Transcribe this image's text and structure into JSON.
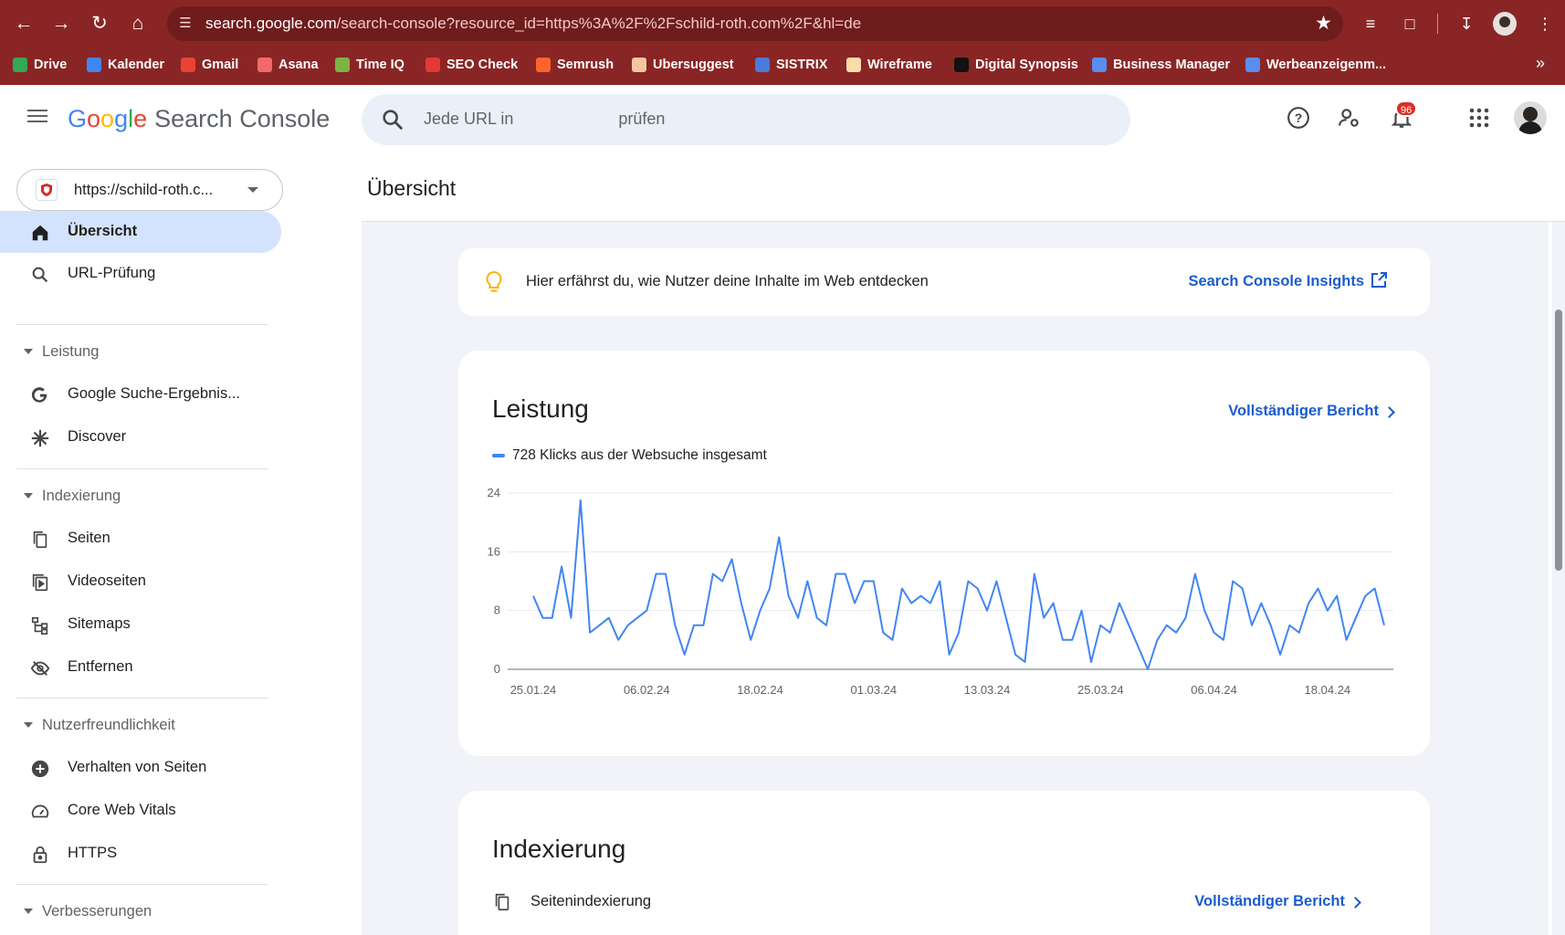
{
  "browser": {
    "url_host": "search.google.com",
    "url_rest": "/search-console?resource_id=https%3A%2F%2Fschild-roth.com%2F&hl=de",
    "bookmarks": [
      {
        "label": "Drive",
        "color": "#34a853"
      },
      {
        "label": "Kalender",
        "color": "#4285f4"
      },
      {
        "label": "Gmail",
        "color": "#ea4335"
      },
      {
        "label": "Asana",
        "color": "#f06a6a"
      },
      {
        "label": "Time IQ",
        "color": "#7cb342"
      },
      {
        "label": "SEO Check",
        "color": "#e53935"
      },
      {
        "label": "Semrush",
        "color": "#ff642d"
      },
      {
        "label": "Ubersuggest",
        "color": "#f4c7a1"
      },
      {
        "label": "SISTRIX",
        "color": "#4a7bd6"
      },
      {
        "label": "Wireframe",
        "color": "#f9dca8"
      },
      {
        "label": "Digital Synopsis",
        "color": "#111111"
      },
      {
        "label": "Business Manager",
        "color": "#5b8def"
      },
      {
        "label": "Werbeanzeigenm...",
        "color": "#5b8def"
      }
    ]
  },
  "header": {
    "logo_g": [
      "G",
      "o",
      "o",
      "g",
      "l",
      "e"
    ],
    "logo_text": "Search Console",
    "search_placeholder": "Jede URL in                       prüfen",
    "notification_count": "96"
  },
  "sidebar": {
    "property": "https://schild-roth.c...",
    "top_items": [
      {
        "label": "Übersicht",
        "icon": "home-icon"
      },
      {
        "label": "URL-Prüfung",
        "icon": "search-icon"
      }
    ],
    "sections": [
      {
        "title": "Leistung",
        "items": [
          {
            "label": "Google Suche-Ergebnis...",
            "icon": "google-g-icon"
          },
          {
            "label": "Discover",
            "icon": "asterisk-icon"
          }
        ]
      },
      {
        "title": "Indexierung",
        "items": [
          {
            "label": "Seiten",
            "icon": "pages-icon"
          },
          {
            "label": "Videoseiten",
            "icon": "video-pages-icon"
          },
          {
            "label": "Sitemaps",
            "icon": "sitemap-icon"
          },
          {
            "label": "Entfernen",
            "icon": "eye-off-icon"
          }
        ]
      },
      {
        "title": "Nutzerfreundlichkeit",
        "items": [
          {
            "label": "Verhalten von Seiten",
            "icon": "plus-circle-icon"
          },
          {
            "label": "Core Web Vitals",
            "icon": "gauge-icon"
          },
          {
            "label": "HTTPS",
            "icon": "lock-icon"
          }
        ]
      },
      {
        "title": "Verbesserungen",
        "items": []
      }
    ]
  },
  "main": {
    "page_title": "Übersicht",
    "insight": {
      "text": "Hier erfährst du, wie Nutzer deine Inhalte im Web entdecken",
      "link": "Search Console Insights"
    },
    "performance": {
      "title": "Leistung",
      "link": "Vollständiger Bericht",
      "legend": "728 Klicks aus der Websuche insgesamt"
    },
    "indexing": {
      "title": "Indexierung",
      "row_label": "Seitenindexierung",
      "link": "Vollständiger Bericht"
    }
  },
  "chart_data": {
    "type": "line",
    "series": [
      {
        "values": [
          10,
          7,
          7,
          14,
          7,
          23,
          5,
          6,
          7,
          4,
          6,
          7,
          8,
          13,
          13,
          6,
          2,
          6,
          6,
          13,
          12,
          15,
          9,
          4,
          8,
          11,
          18,
          10,
          7,
          12,
          7,
          6,
          13,
          13,
          9,
          12,
          12,
          5,
          4,
          11,
          9,
          10,
          9,
          12,
          2,
          5,
          12,
          11,
          8,
          12,
          7,
          2,
          1,
          13,
          7,
          9,
          4,
          4,
          8,
          1,
          6,
          5,
          9,
          6,
          3,
          0,
          4,
          6,
          5,
          7,
          13,
          8,
          5,
          4,
          12,
          11,
          6,
          9,
          6,
          2,
          6,
          5,
          9,
          11,
          8,
          10,
          4,
          7,
          10,
          11,
          6
        ]
      }
    ],
    "x_tick_labels": [
      "25.01.24",
      "06.02.24",
      "18.02.24",
      "01.03.24",
      "13.03.24",
      "25.03.24",
      "06.04.24",
      "18.04.24"
    ],
    "y_ticks": [
      0,
      8,
      16,
      24
    ],
    "ylim": [
      0,
      24
    ],
    "color": "#4285f4",
    "grid": true
  }
}
